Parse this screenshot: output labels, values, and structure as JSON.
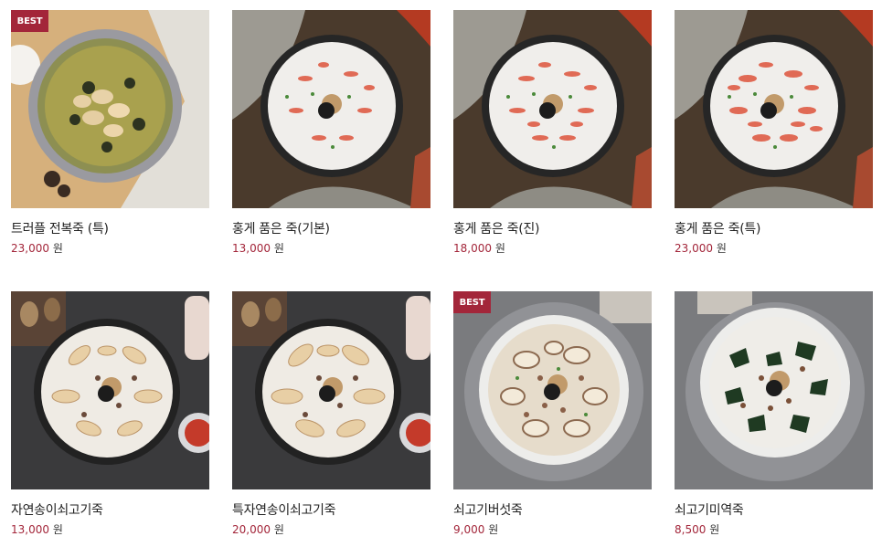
{
  "badge_label": "BEST",
  "currency_label": "원",
  "colors": {
    "accent": "#a3263a",
    "text": "#222222"
  },
  "products": [
    {
      "name": "트러플 전복죽 (특)",
      "price": "23,000",
      "best": true,
      "image": "abalone-porridge-image"
    },
    {
      "name": "홍게 품은 죽(기본)",
      "price": "13,000",
      "best": false,
      "image": "red-crab-porridge-image"
    },
    {
      "name": "홍게 품은 죽(진)",
      "price": "18,000",
      "best": false,
      "image": "red-crab-porridge-image"
    },
    {
      "name": "홍게 품은 죽(특)",
      "price": "23,000",
      "best": false,
      "image": "red-crab-porridge-image"
    },
    {
      "name": "자연송이쇠고기죽",
      "price": "13,000",
      "best": false,
      "image": "pine-mushroom-beef-porridge-image"
    },
    {
      "name": "특자연송이쇠고기죽",
      "price": "20,000",
      "best": false,
      "image": "pine-mushroom-beef-porridge-image"
    },
    {
      "name": "쇠고기버섯죽",
      "price": "9,000",
      "best": true,
      "image": "beef-mushroom-porridge-image"
    },
    {
      "name": "쇠고기미역죽",
      "price": "8,500",
      "best": false,
      "image": "beef-seaweed-porridge-image"
    }
  ]
}
